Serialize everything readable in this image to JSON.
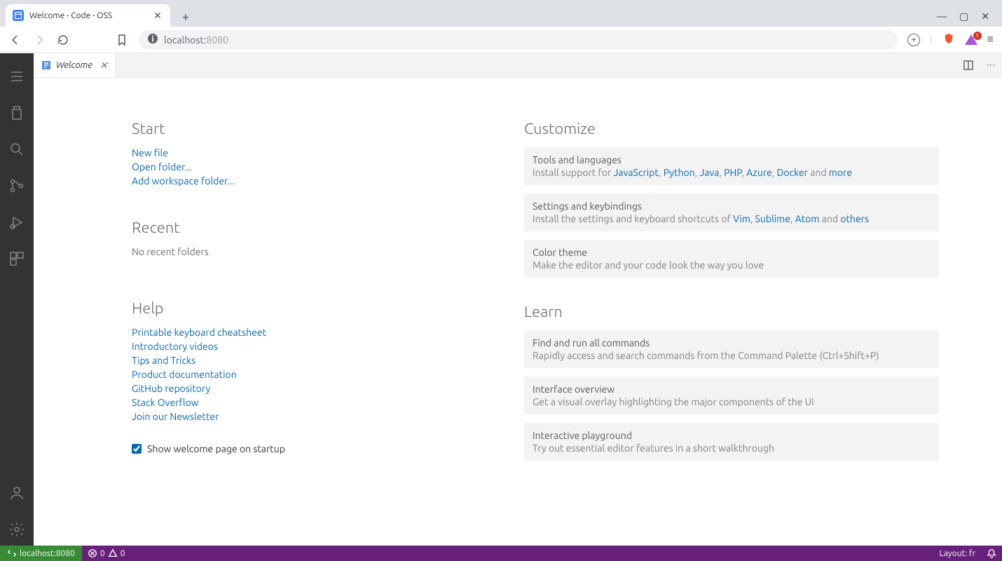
{
  "browser": {
    "tab_title": "Welcome - Code - OSS",
    "address_host": "localhost:",
    "address_port": "8080",
    "badge_count": "1"
  },
  "editor": {
    "tab_label": "Welcome"
  },
  "welcome": {
    "start": {
      "heading": "Start",
      "new_file": "New file",
      "open_folder": "Open folder...",
      "add_workspace": "Add workspace folder..."
    },
    "recent": {
      "heading": "Recent",
      "empty": "No recent folders"
    },
    "help": {
      "heading": "Help",
      "items": [
        "Printable keyboard cheatsheet",
        "Introductory videos",
        "Tips and Tricks",
        "Product documentation",
        "GitHub repository",
        "Stack Overflow",
        "Join our Newsletter"
      ]
    },
    "show_on_startup": "Show welcome page on startup",
    "customize": {
      "heading": "Customize",
      "tools": {
        "title": "Tools and languages",
        "prefix": "Install support for ",
        "links": [
          "JavaScript",
          "Python",
          "Java",
          "PHP",
          "Azure",
          "Docker"
        ],
        "and": " and ",
        "more": "more"
      },
      "settings": {
        "title": "Settings and keybindings",
        "prefix": "Install the settings and keyboard shortcuts of ",
        "links": [
          "Vim",
          "Sublime",
          "Atom"
        ],
        "and": " and ",
        "others": "others"
      },
      "theme": {
        "title": "Color theme",
        "desc": "Make the editor and your code look the way you love"
      }
    },
    "learn": {
      "heading": "Learn",
      "commands": {
        "title": "Find and run all commands",
        "desc": "Rapidly access and search commands from the Command Palette (Ctrl+Shift+P)"
      },
      "overview": {
        "title": "Interface overview",
        "desc": "Get a visual overlay highlighting the major components of the UI"
      },
      "playground": {
        "title": "Interactive playground",
        "desc": "Try out essential editor features in a short walkthrough"
      }
    }
  },
  "statusbar": {
    "remote": "localhost:8080",
    "errors": "0",
    "warnings": "0",
    "layout": "Layout: fr"
  }
}
